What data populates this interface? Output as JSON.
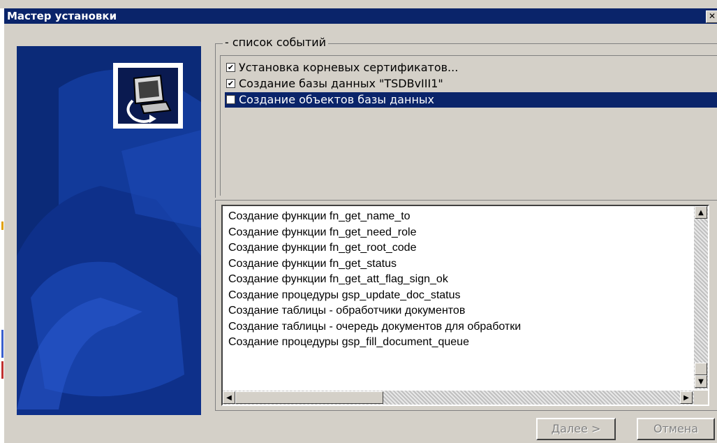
{
  "window": {
    "title": "Мастер установки",
    "close_glyph": "✕"
  },
  "events_group": {
    "legend": "- список событий",
    "items": [
      {
        "label": "Установка корневых сертификатов...",
        "checked": true,
        "selected": false
      },
      {
        "label": "Создание базы данных \"TSDBvIII1\"",
        "checked": true,
        "selected": false
      },
      {
        "label": "Создание объектов базы данных",
        "checked": false,
        "selected": true
      }
    ]
  },
  "log": {
    "lines": [
      "Создание функции fn_get_name_to",
      "Создание функции fn_get_need_role",
      "Создание функции fn_get_root_code",
      "Создание функции fn_get_status",
      "Создание функции fn_get_att_flag_sign_ok",
      "Создание процедуры gsp_update_doc_status",
      "Создание таблицы - обработчики документов",
      "Создание таблицы - очередь документов для обработки",
      "Создание процедуры gsp_fill_document_queue"
    ]
  },
  "buttons": {
    "next": "Далее >",
    "cancel": "Отмена"
  },
  "icons": {
    "banner": "computer-install-icon",
    "scroll_up": "arrow-up-icon",
    "scroll_down": "arrow-down-icon",
    "scroll_left": "arrow-left-icon",
    "scroll_right": "arrow-right-icon"
  },
  "colors": {
    "titlebar": "#0a246a",
    "selection": "#0a246a",
    "banner": "#0b2a78",
    "dialog": "#d4d0c8"
  }
}
